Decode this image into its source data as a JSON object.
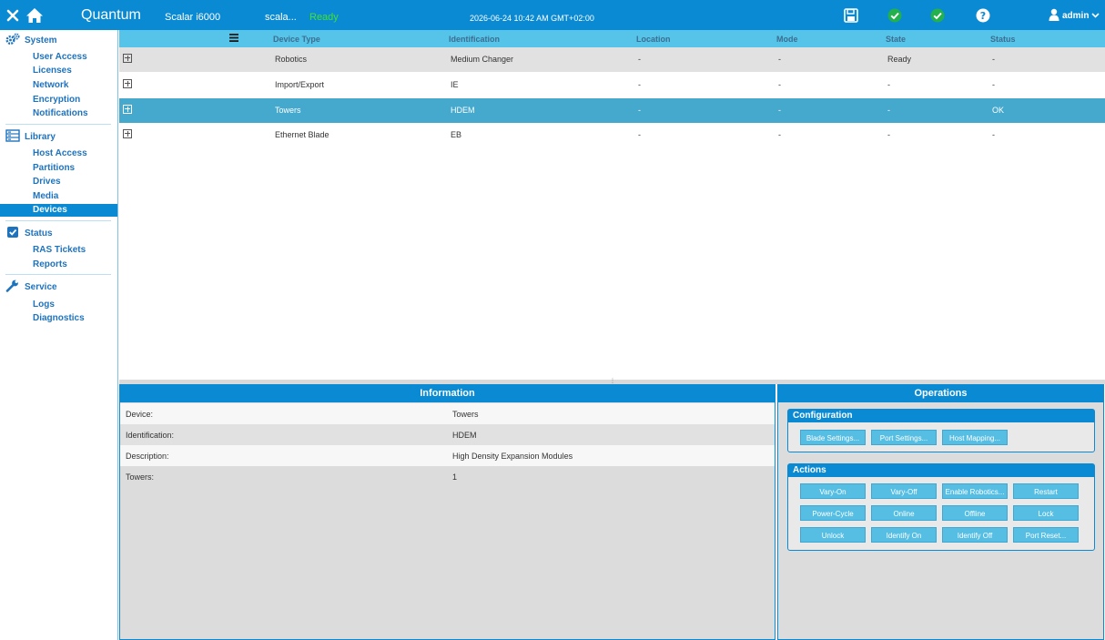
{
  "header": {
    "brand": "Quantum",
    "product": "Scalar i6000",
    "library_name": "scala...",
    "library_state": "Ready",
    "datetime": "2026-06-24 10:42 AM GMT+02:00",
    "user": "admin",
    "icons": [
      "close-icon",
      "home-icon",
      "save-icon",
      "check-icon",
      "check-icon",
      "help-icon",
      "user-icon"
    ],
    "colors": {
      "bar": "#0a8ad3",
      "ready": "#44e033",
      "check": "#22b14c"
    }
  },
  "sidebar": {
    "sections": [
      {
        "title": "System",
        "icon": "gears-icon",
        "items": [
          "User Access",
          "Licenses",
          "Network",
          "Encryption",
          "Notifications"
        ]
      },
      {
        "title": "Library",
        "icon": "library-icon",
        "items": [
          "Host Access",
          "Partitions",
          "Drives",
          "Media",
          "Devices"
        ]
      },
      {
        "title": "Status",
        "icon": "checkbox-icon",
        "items": [
          "RAS Tickets",
          "Reports"
        ]
      },
      {
        "title": "Service",
        "icon": "wrench-icon",
        "items": [
          "Logs",
          "Diagnostics"
        ]
      }
    ],
    "active_item": "Devices"
  },
  "table": {
    "columns": [
      "Device Type",
      "Identification",
      "Location",
      "Mode",
      "State",
      "Status"
    ],
    "rows": [
      [
        "Robotics",
        "Medium Changer",
        "-",
        "-",
        "Ready",
        "-"
      ],
      [
        "Import/Export",
        "IE",
        "-",
        "-",
        "-",
        "-"
      ],
      [
        "Towers",
        "HDEM",
        "-",
        "-",
        "-",
        "OK"
      ],
      [
        "Ethernet Blade",
        "EB",
        "-",
        "-",
        "-",
        "-"
      ]
    ],
    "selected_row": 2
  },
  "information": {
    "title": "Information",
    "fields": [
      {
        "label": "Device:",
        "value": "Towers"
      },
      {
        "label": "Identification:",
        "value": "HDEM"
      },
      {
        "label": "Description:",
        "value": "High Density Expansion Modules"
      },
      {
        "label": "Towers:",
        "value": "1"
      }
    ]
  },
  "operations": {
    "title": "Operations",
    "configuration": {
      "title": "Configuration",
      "buttons": [
        "Blade Settings...",
        "Port Settings...",
        "Host Mapping..."
      ]
    },
    "actions": {
      "title": "Actions",
      "buttons": [
        "Vary-On",
        "Vary-Off",
        "Enable Robotics...",
        "Restart",
        "Power-Cycle",
        "Online",
        "Offline",
        "Lock",
        "Unlock",
        "Identify On",
        "Identify Off",
        "Port Reset..."
      ]
    }
  }
}
